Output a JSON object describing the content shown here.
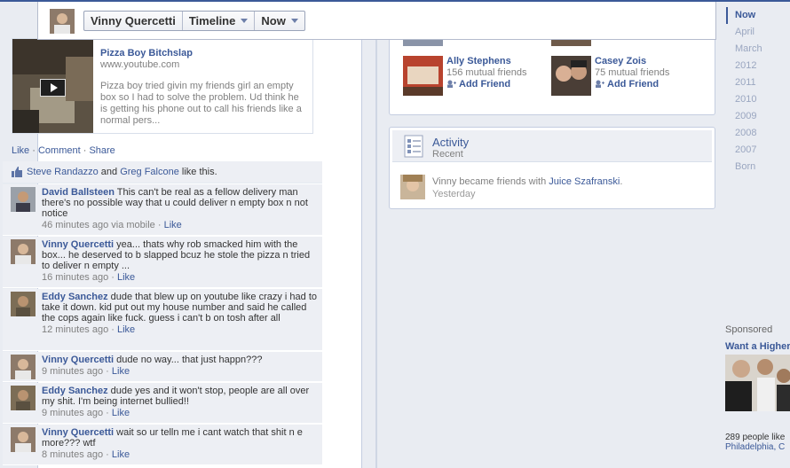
{
  "header": {
    "name": "Vinny Quercetti",
    "timeline_label": "Timeline",
    "now_label": "Now"
  },
  "post": {
    "link_title": "Pizza Boy Bitchslap",
    "link_domain": "www.youtube.com",
    "link_desc": "Pizza boy tried givin my friends girl an empty box so I had to solve the problem. Ud think he is getting his phone out to call his friends like a normal pers...",
    "actions": {
      "like": "Like",
      "comment": "Comment",
      "share": "Share",
      "sep": " · "
    },
    "likes": {
      "person1": "Steve Randazzo",
      "and": " and ",
      "person2": "Greg Falcone",
      "suffix": " like this."
    }
  },
  "comments": [
    {
      "name": "David Ballsteen",
      "text": "This can't be real as a fellow delivery man there's no possible way that u could deliver n empty box n not notice",
      "time": "46 minutes ago via mobile",
      "like": "Like"
    },
    {
      "name": "Vinny Quercetti",
      "text": "yea... thats why rob smacked him with the box... he deserved to b slapped bcuz he stole the pizza n tried to deliver n empty ...",
      "time": "16 minutes ago",
      "like": "Like"
    },
    {
      "name": "Eddy Sanchez",
      "text": "dude that blew up on youtube like crazy i had to take it down. kid put out my house number and said he called the cops again like fuck. guess i can't b on tosh after all",
      "time": "12 minutes ago",
      "like": "Like"
    },
    {
      "name": "Vinny Quercetti",
      "text": "dude no way... that just happn???",
      "time": "9 minutes ago",
      "like": "Like"
    },
    {
      "name": "Eddy Sanchez",
      "text": "dude yes and it won't stop, people are all over my shit. I'm being internet bullied!!",
      "time": "9 minutes ago",
      "like": "Like"
    },
    {
      "name": "Vinny Quercetti",
      "text": "wait so ur telln me i cant watch that shit n e more??? wtf",
      "time": "8 minutes ago",
      "like": "Like"
    }
  ],
  "friends": [
    {
      "name": "Ally Stephens",
      "mutual": "156 mutual friends",
      "add": "Add Friend"
    },
    {
      "name": "Casey Zois",
      "mutual": "75 mutual friends",
      "add": "Add Friend"
    }
  ],
  "activity": {
    "title": "Activity",
    "subtitle": "Recent",
    "item_prefix": "Vinny became friends with ",
    "item_link": "Juice Szafranski",
    "item_suffix": ".",
    "item_time": "Yesterday"
  },
  "scrubber": [
    "Now",
    "April",
    "March",
    "2012",
    "2011",
    "2010",
    "2009",
    "2008",
    "2007",
    "Born"
  ],
  "sponsored": {
    "label": "Sponsored",
    "title": "Want a Higher",
    "likes_line1": "289 people like",
    "likes_line2": "Philadelphia, C"
  },
  "colors": {
    "link": "#3b5998",
    "background": "#e9ecf2",
    "comment_bg": "#edeff4"
  }
}
